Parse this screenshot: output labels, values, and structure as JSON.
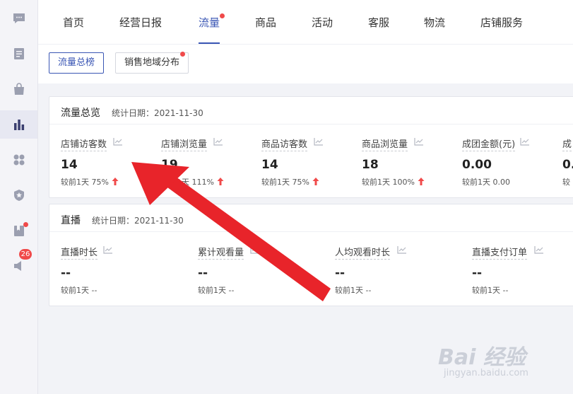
{
  "sidebar": {
    "items": [
      {
        "icon": "chat-icon"
      },
      {
        "icon": "document-icon"
      },
      {
        "icon": "shopping-bag-icon"
      },
      {
        "icon": "bar-chart-icon",
        "active": true
      },
      {
        "icon": "apps-icon"
      },
      {
        "icon": "shield-star-icon"
      },
      {
        "icon": "bookmark-icon",
        "dot": true
      },
      {
        "icon": "speaker-icon",
        "badge": "26"
      }
    ]
  },
  "nav": {
    "tabs": [
      {
        "label": "首页"
      },
      {
        "label": "经营日报"
      },
      {
        "label": "流量",
        "active": true,
        "dot": true
      },
      {
        "label": "商品"
      },
      {
        "label": "活动"
      },
      {
        "label": "客服"
      },
      {
        "label": "物流"
      },
      {
        "label": "店铺服务"
      }
    ]
  },
  "subnav": {
    "buttons": [
      {
        "label": "流量总榜",
        "active": true
      },
      {
        "label": "销售地域分布",
        "dot": true
      }
    ]
  },
  "traffic_overview": {
    "title": "流量总览",
    "date": "统计日期：2021-11-30",
    "metrics": [
      {
        "label": "店铺访客数",
        "value": "14",
        "compare": "较前1天 75%",
        "trend": "up"
      },
      {
        "label": "店铺浏览量",
        "value": "19",
        "compare": "较前1天 111%",
        "trend": "up"
      },
      {
        "label": "商品访客数",
        "value": "14",
        "compare": "较前1天 75%",
        "trend": "up"
      },
      {
        "label": "商品浏览量",
        "value": "18",
        "compare": "较前1天 100%",
        "trend": "up"
      },
      {
        "label": "成团金额(元)",
        "value": "0.00",
        "compare": "较前1天 0.00",
        "trend": "none"
      },
      {
        "label": "成",
        "value": "0.",
        "compare": "较",
        "trend": "none"
      }
    ]
  },
  "live": {
    "title": "直播",
    "date": "统计日期：2021-11-30",
    "metrics": [
      {
        "label": "直播时长",
        "value": "--",
        "compare": "较前1天 --"
      },
      {
        "label": "累计观看量",
        "value": "--",
        "compare": "较前1天 --"
      },
      {
        "label": "人均观看时长",
        "value": "--",
        "compare": "较前1天 --"
      },
      {
        "label": "直播支付订单",
        "value": "--",
        "compare": "较前1天 --"
      }
    ]
  },
  "colors": {
    "accent": "#3a56b4",
    "notify": "#f04a4a",
    "arrow": "#e8242a",
    "up": "#f04a4a"
  },
  "watermark": {
    "main": "Bai 经验",
    "sub": "jingyan.baidu.com"
  }
}
